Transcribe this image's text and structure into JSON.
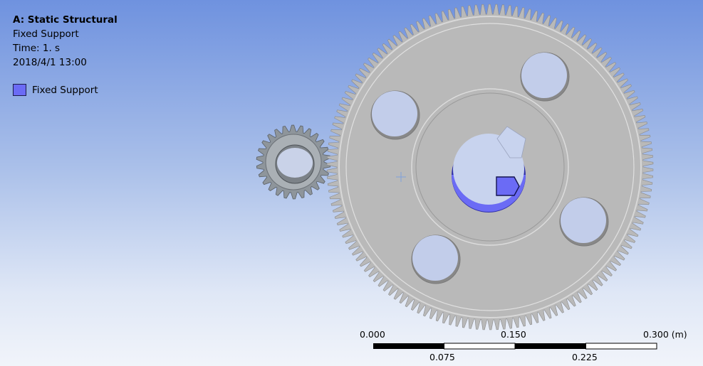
{
  "info": {
    "title": "A: Static Structural",
    "line1": "Fixed Support",
    "line2": "Time: 1. s",
    "line3": "2018/4/1 13:00"
  },
  "legend": {
    "label": "Fixed Support",
    "color": "#6b6bf5"
  },
  "scale": {
    "top_labels": [
      "0.000",
      "0.150",
      "0.300 (m)"
    ],
    "bottom_labels": [
      "0.075",
      "0.225"
    ]
  },
  "colors": {
    "gear": "#b9b9b9",
    "gear_edge": "#7a7a7a",
    "support": "#6b6bf5"
  }
}
